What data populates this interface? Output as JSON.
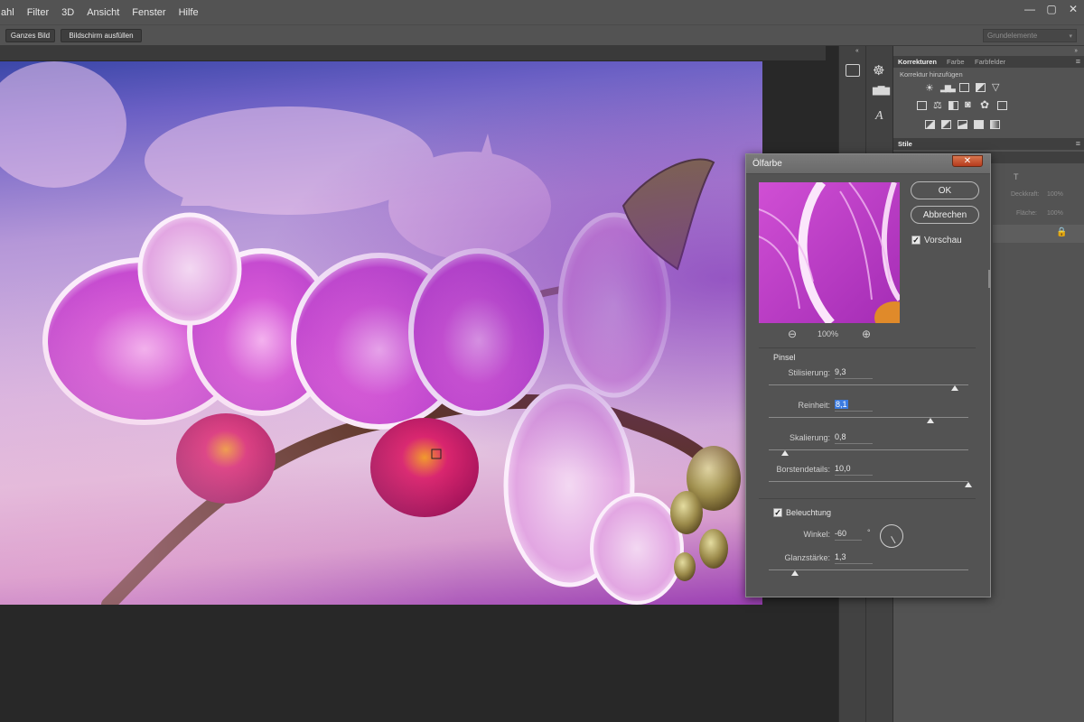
{
  "menubar": {
    "items": [
      "ahl",
      "Filter",
      "3D",
      "Ansicht",
      "Fenster",
      "Hilfe"
    ],
    "window_controls": [
      "—",
      "▢",
      "✕"
    ]
  },
  "optbar": {
    "fit_all_label": "Ganzes Bild",
    "fill_screen_label": "Bildschirm ausfüllen",
    "workspace": "Grundelemente"
  },
  "panels": {
    "tabs": [
      "Korrekturen",
      "Farbe",
      "Farbfelder"
    ],
    "add_adjustment": "Korrektur hinzufügen",
    "styles_tab": "Stile",
    "opacity_label": "Deckkraft:",
    "opacity_value": "100%",
    "fill_label": "Fläche:",
    "fill_value": "100%"
  },
  "dialog": {
    "title": "Ölfarbe",
    "ok_label": "OK",
    "cancel_label": "Abbrechen",
    "preview_label": "Vorschau",
    "preview_checked": true,
    "zoom": "100%",
    "brush_section": "Pinsel",
    "stylization_label": "Stilisierung:",
    "stylization_value": "9,3",
    "stylization_level": 0.93,
    "cleanliness_label": "Reinheit:",
    "cleanliness_value": "8,1",
    "cleanliness_level": 0.81,
    "scale_label": "Skalierung:",
    "scale_value": "0,8",
    "scale_level": 0.08,
    "bristle_label": "Borstendetails:",
    "bristle_value": "10,0",
    "bristle_level": 1.0,
    "lighting_label": "Beleuchtung",
    "lighting_checked": true,
    "angle_label": "Winkel:",
    "angle_value": "-60",
    "angle_unit": "°",
    "shine_label": "Glanzstärke:",
    "shine_value": "1,3",
    "shine_level": 0.13
  },
  "colors": {
    "menubar": "#535353",
    "panel": "#535353",
    "selection": "#3b7be0",
    "close_button": "#c8522f"
  }
}
